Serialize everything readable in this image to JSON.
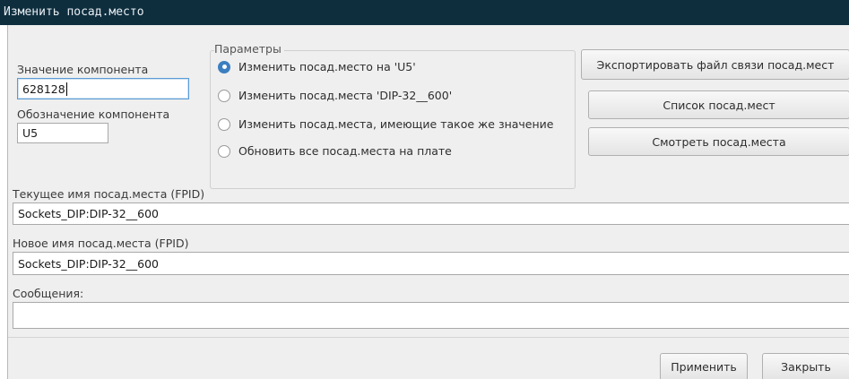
{
  "window": {
    "title": "Изменить посад.место"
  },
  "component": {
    "value_label": "Значение компонента",
    "value": "628128",
    "reference_label": "Обозначение компонента",
    "reference": "U5"
  },
  "params": {
    "title": "Параметры",
    "options": [
      {
        "label": "Изменить посад.место на 'U5'",
        "checked": true
      },
      {
        "label": "Изменить посад.места 'DIP-32__600'",
        "checked": false
      },
      {
        "label": "Изменить посад.места, имеющие такое же значение",
        "checked": false
      },
      {
        "label": "Обновить все посад.места на плате",
        "checked": false
      }
    ]
  },
  "actions": {
    "export_label": "Экспортировать файл связи посад.мест",
    "list_label": "Список посад.мест",
    "view_label": "Смотреть посад.места"
  },
  "fpid": {
    "current_label": "Текущее имя посад.места (FPID)",
    "current_value": "Sockets_DIP:DIP-32__600",
    "new_label": "Новое имя посад.места (FPID)",
    "new_value": "Sockets_DIP:DIP-32__600"
  },
  "messages": {
    "label": "Сообщения:",
    "value": ""
  },
  "footer": {
    "apply_label": "Применить",
    "close_label": "Закрыть"
  }
}
